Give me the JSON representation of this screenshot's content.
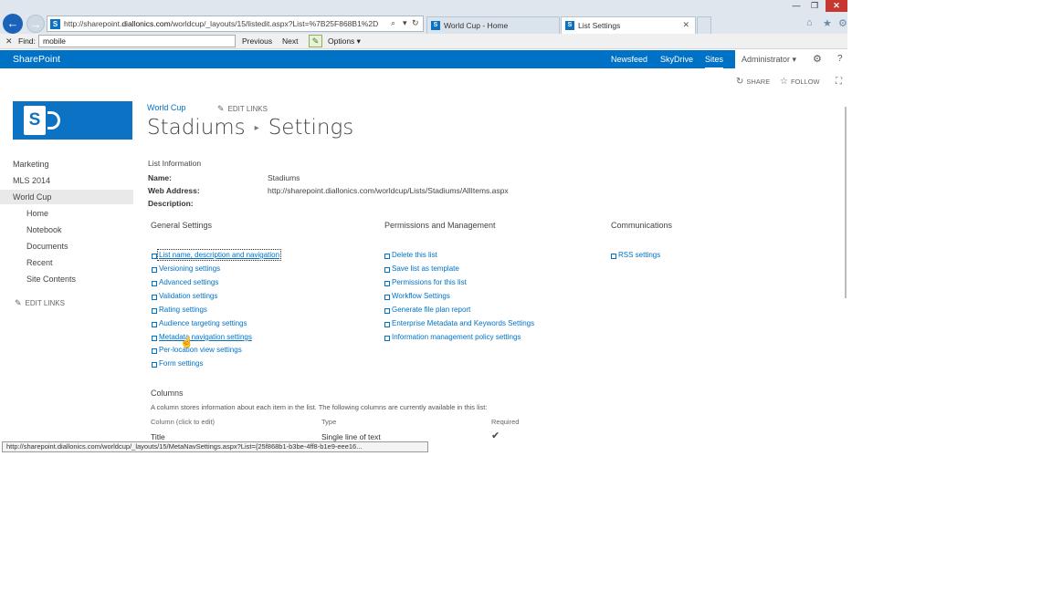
{
  "browser": {
    "address_host": "http://sharepoint.",
    "address_domain": "diallonics.com",
    "address_path": "/worldcup/_layouts/15/listedit.aspx?List=%7B25F868B1%2D",
    "tabs": [
      {
        "label": "World Cup - Home"
      },
      {
        "label": "List Settings"
      }
    ],
    "window_min": "—",
    "window_max": "❐",
    "window_close": "✕"
  },
  "findbar": {
    "label": "Find:",
    "value": "mobile",
    "previous": "Previous",
    "next": "Next",
    "options": "Options"
  },
  "suitebar": {
    "brand": "SharePoint",
    "links": [
      "Newsfeed",
      "SkyDrive",
      "Sites"
    ],
    "selected": "Sites",
    "user": "Administrator"
  },
  "page_actions": {
    "share": "SHARE",
    "follow": "FOLLOW"
  },
  "header": {
    "site": "World Cup",
    "edit_links": "EDIT LINKS",
    "title_list": "Stadiums",
    "title_page": "Settings"
  },
  "left_nav": {
    "items": [
      "Marketing",
      "MLS 2014",
      "World Cup"
    ],
    "sub_items": [
      "Home",
      "Notebook",
      "Documents",
      "Recent",
      "Site Contents"
    ],
    "edit_links": "EDIT LINKS"
  },
  "list_info": {
    "heading": "List Information",
    "name_label": "Name:",
    "name_value": "Stadiums",
    "address_label": "Web Address:",
    "address_value": "http://sharepoint.diallonics.com/worldcup/Lists/Stadiums/AllItems.aspx",
    "description_label": "Description:"
  },
  "sections": {
    "general": {
      "heading": "General Settings",
      "links": [
        "List name, description and navigation",
        "Versioning settings",
        "Advanced settings",
        "Validation settings",
        "Rating settings",
        "Audience targeting settings",
        "Metadata navigation settings",
        "Per-location view settings",
        "Form settings"
      ]
    },
    "permissions": {
      "heading": "Permissions and Management",
      "links": [
        "Delete this list",
        "Save list as template",
        "Permissions for this list",
        "Workflow Settings",
        "Generate file plan report",
        "Enterprise Metadata and Keywords Settings",
        "Information management policy settings"
      ]
    },
    "communications": {
      "heading": "Communications",
      "links": [
        "RSS settings"
      ]
    }
  },
  "columns": {
    "heading": "Columns",
    "description": "A column stores information about each item in the list. The following columns are currently available in this list:",
    "headers": [
      "Column (click to edit)",
      "Type",
      "Required"
    ],
    "rows": [
      {
        "name": "Title",
        "type": "Single line of text",
        "required": "✔"
      }
    ]
  },
  "status_bar": {
    "url": "http://sharepoint.diallonics.com/worldcup/_layouts/15/MetaNavSettings.aspx?List={25f868b1-b3be-4ff8-b1e9-eee16..."
  },
  "colors": {
    "suite_blue": "#0072c6",
    "link_blue": "#0072c6",
    "close_red": "#c7372f"
  },
  "icons": [
    "back-arrow-icon",
    "forward-arrow-icon",
    "search-icon",
    "refresh-icon",
    "close-icon",
    "home-icon",
    "favorites-star-icon",
    "settings-gear-icon",
    "pencil-icon",
    "share-icon",
    "follow-star-icon",
    "focus-icon",
    "help-icon",
    "checkmark-icon"
  ]
}
